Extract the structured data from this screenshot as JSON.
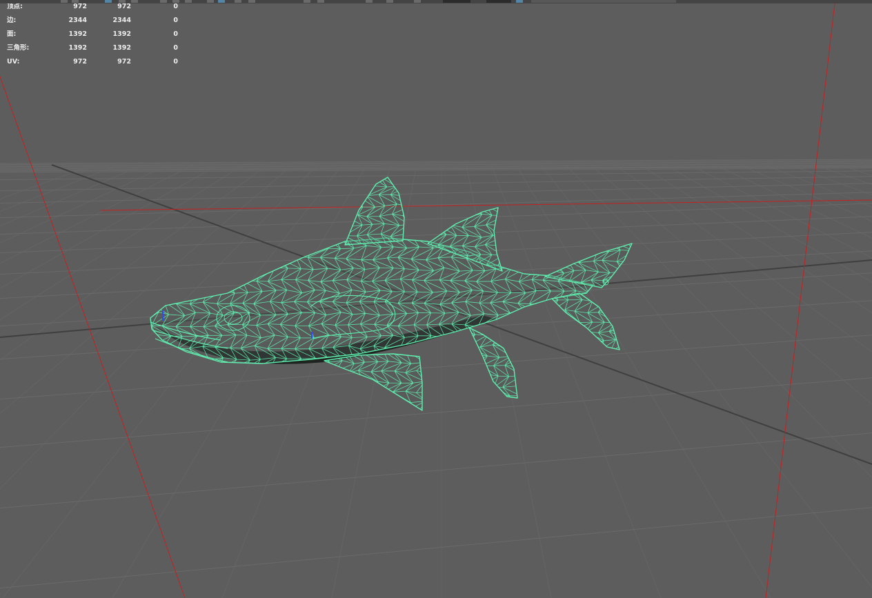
{
  "hud": {
    "rows": [
      {
        "label": "顶点:",
        "values": [
          "972",
          "972",
          "0"
        ]
      },
      {
        "label": "边:",
        "values": [
          "2344",
          "2344",
          "0"
        ]
      },
      {
        "label": "面:",
        "values": [
          "1392",
          "1392",
          "0"
        ]
      },
      {
        "label": "三角形:",
        "values": [
          "1392",
          "1392",
          "0"
        ]
      },
      {
        "label": "UV:",
        "values": [
          "972",
          "972",
          "0"
        ]
      }
    ]
  },
  "colors": {
    "background": "#5d5d5d",
    "grid": "#6a6a6a",
    "axis_dark": "#3f3f3f",
    "camera_red": "#c62020",
    "wireframe": "#5ff0b0",
    "mesh_fill": "#525858",
    "mesh_shadow": "#1e2420",
    "toolbar_active": "#5285a6"
  },
  "icons": [
    "move-tool-icon",
    "select-tool-icon",
    "snap-icon",
    "camera-icon",
    "render-icon"
  ]
}
